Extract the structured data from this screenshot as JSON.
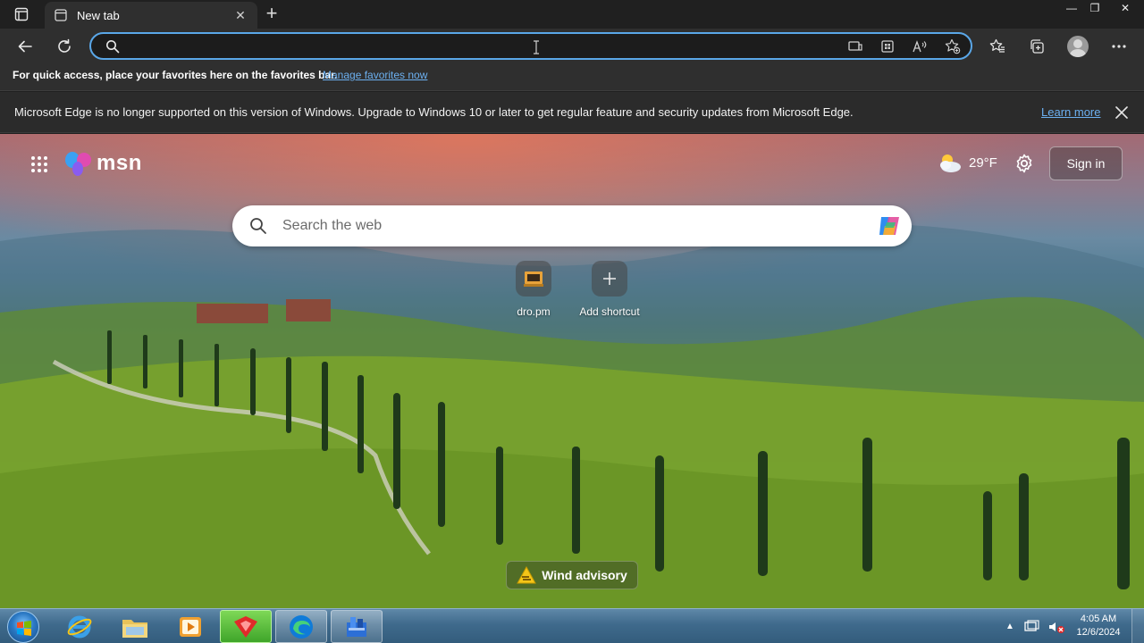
{
  "browser": {
    "tab": {
      "title": "New tab",
      "close_label": "✕"
    },
    "new_tab_label": "+",
    "window_controls": {
      "minimize": "—",
      "restore": "❐",
      "close": "✕"
    },
    "address": {
      "value": "",
      "placeholder": ""
    },
    "icons": {
      "back": "back-arrow-icon",
      "refresh": "refresh-icon",
      "address_search": "search-icon",
      "immersive_reader": "immersive-reader-icon",
      "apps": "apps-icon",
      "read_aloud": "read-aloud-icon",
      "add_favorite": "add-favorite-star-icon",
      "favorites": "favorites-icon",
      "collections": "collections-icon",
      "profile": "profile-avatar",
      "menu": "more-menu-icon"
    }
  },
  "favorites_bar": {
    "text": "For quick access, place your favorites here on the favorites bar.",
    "link": "Manage favorites now"
  },
  "info_bar": {
    "message": "Microsoft Edge is no longer supported on this version of Windows. Upgrade to Windows 10 or later to get regular feature and security updates from Microsoft Edge.",
    "link": "Learn more"
  },
  "msn": {
    "logo_text": "msn",
    "weather": {
      "temp": "29°F"
    },
    "signin_label": "Sign in",
    "search": {
      "placeholder": "Search the web"
    },
    "shortcuts": [
      {
        "label": "dro.pm"
      },
      {
        "label": "Add shortcut"
      }
    ],
    "advisory": "Wind advisory"
  },
  "taskbar": {
    "apps": [
      "internet-explorer-icon",
      "file-explorer-icon",
      "media-player-icon",
      "red-app-icon",
      "edge-icon",
      "blue-app-icon"
    ],
    "tray_up": "▲",
    "clock": {
      "time": "4:05 AM",
      "date": "12/6/2024"
    }
  },
  "colors": {
    "accent_focus": "#5aa7e8",
    "link": "#6cb0f0",
    "chrome_bg": "#2f2f2f"
  }
}
